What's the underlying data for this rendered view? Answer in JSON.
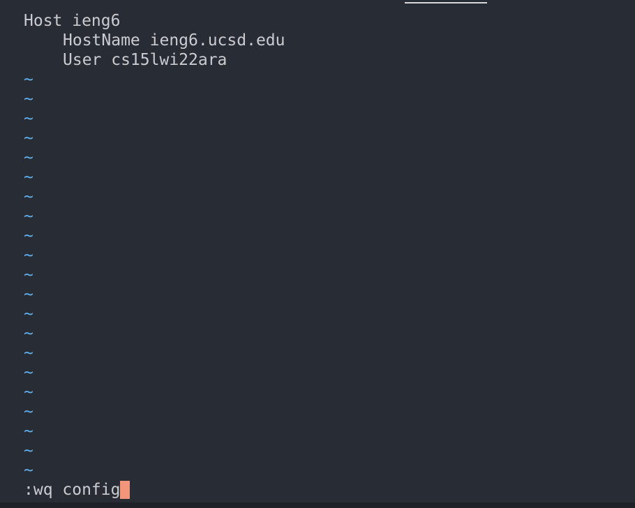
{
  "file_lines": [
    "Host ieng6",
    "HostName ieng6.ucsd.edu",
    "User cs15lwi22ara"
  ],
  "empty_line_marker": "~",
  "command_line": ":wq config",
  "colors": {
    "background": "#282c34",
    "text": "#c9ccd1",
    "tilde": "#61afef",
    "cursor": "#f2957a"
  }
}
